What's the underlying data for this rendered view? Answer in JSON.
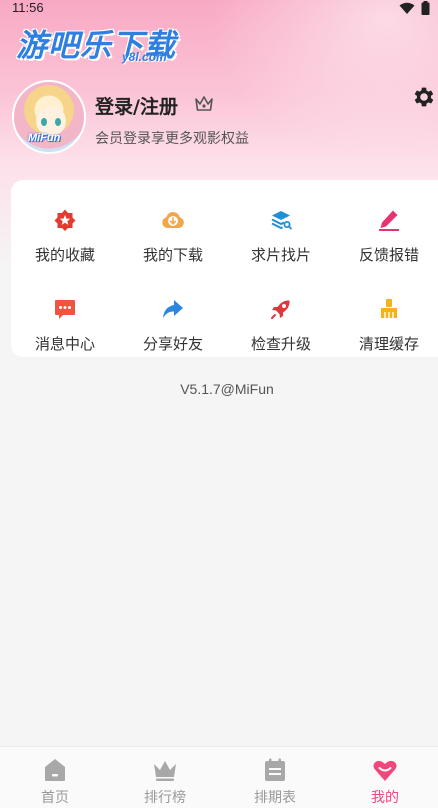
{
  "status": {
    "time": "11:56"
  },
  "logo": {
    "title": "游吧乐下载",
    "subtitle": "y8l.com"
  },
  "profile": {
    "avatar_tag": "MiFun",
    "login_label": "登录/注册",
    "subtitle": "会员登录享更多观影权益"
  },
  "menu": [
    {
      "label": "我的收藏",
      "icon": "star-badge-icon",
      "color": "#e23b2f"
    },
    {
      "label": "我的下载",
      "icon": "cloud-download-icon",
      "color": "#f2a64c"
    },
    {
      "label": "求片找片",
      "icon": "search-layers-icon",
      "color": "#1f8fd6"
    },
    {
      "label": "反馈报错",
      "icon": "edit-pen-icon",
      "color": "#e8336f"
    },
    {
      "label": "消息中心",
      "icon": "message-icon",
      "color": "#f0543f"
    },
    {
      "label": "分享好友",
      "icon": "share-icon",
      "color": "#2a86e0"
    },
    {
      "label": "检查升级",
      "icon": "rocket-icon",
      "color": "#e0373a"
    },
    {
      "label": "清理缓存",
      "icon": "broom-icon",
      "color": "#f5b21b"
    }
  ],
  "version": "V5.1.7@MiFun",
  "tabs": [
    {
      "label": "首页",
      "icon": "home-icon",
      "active": false
    },
    {
      "label": "排行榜",
      "icon": "crown-icon",
      "active": false
    },
    {
      "label": "排期表",
      "icon": "calendar-icon",
      "active": false
    },
    {
      "label": "我的",
      "icon": "heart-icon",
      "active": true
    }
  ],
  "colors": {
    "accent": "#f1477d",
    "inactive": "#9a9a9a",
    "logo": "#2e7fe0"
  }
}
